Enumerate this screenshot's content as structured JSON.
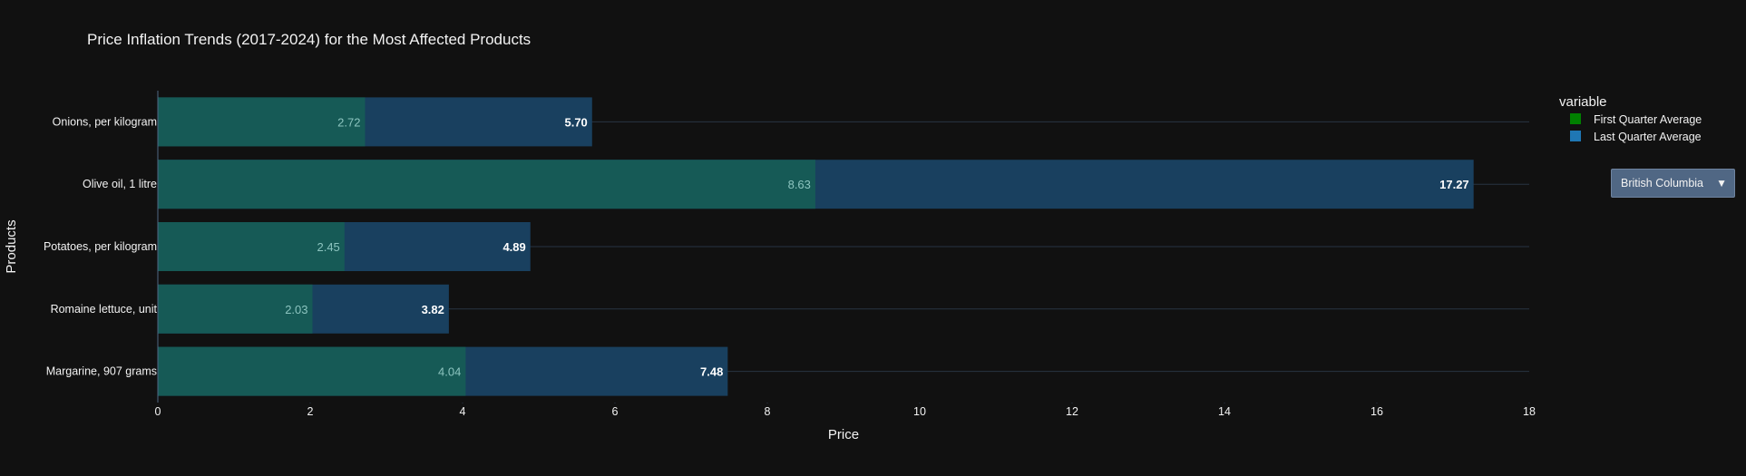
{
  "chart_data": {
    "type": "bar",
    "orientation": "horizontal",
    "barmode": "overlay",
    "title": "Price Inflation Trends (2017-2024) for the Most Affected Products",
    "xlabel": "Price",
    "ylabel": "Products",
    "xlim": [
      0,
      18
    ],
    "xticks": [
      0,
      2,
      4,
      6,
      8,
      10,
      12,
      14,
      16,
      18
    ],
    "grid": true,
    "legend_placement": "top-right",
    "legend_title": "variable",
    "categories": [
      "Onions, per kilogram",
      "Olive oil, 1 litre",
      "Potatoes, per kilogram",
      "Romaine lettuce, unit",
      "Margarine, 907 grams"
    ],
    "series": [
      {
        "name": "First Quarter Average",
        "color": "#008000",
        "values": [
          2.72,
          8.63,
          2.45,
          2.03,
          4.04
        ],
        "labels": [
          "2.72",
          "8.63",
          "2.45",
          "2.03",
          "4.04"
        ]
      },
      {
        "name": "Last Quarter Average",
        "color": "#1f77b4",
        "values": [
          5.7,
          17.27,
          4.89,
          3.82,
          7.48
        ],
        "labels": [
          "5.70",
          "17.27",
          "4.89",
          "3.82",
          "7.48"
        ]
      }
    ]
  },
  "controls": {
    "region_dropdown": {
      "selected": "British Columbia",
      "arrow_icon": "triangle-down-icon"
    }
  }
}
